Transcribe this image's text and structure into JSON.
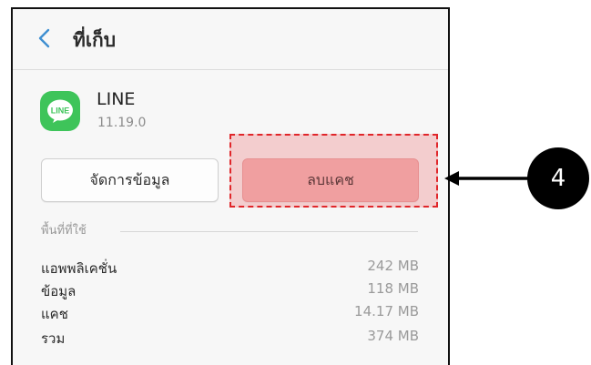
{
  "header": {
    "back_icon": "chevron-left-icon",
    "title": "ที่เก็บ"
  },
  "app": {
    "icon": "line-app-icon",
    "icon_text": "LINE",
    "name": "LINE",
    "version": "11.19.0"
  },
  "buttons": {
    "manage_data_label": "จัดการข้อมูล",
    "clear_cache_label": "ลบแคช"
  },
  "storage": {
    "section_label": "พื้นที่ที่ใช้",
    "rows": [
      {
        "label": "แอพพลิเคชั่น",
        "value": "242 MB"
      },
      {
        "label": "ข้อมูล",
        "value": "118 MB"
      },
      {
        "label": "แคช",
        "value": "14.17 MB"
      },
      {
        "label": "รวม",
        "value": "374 MB"
      }
    ]
  },
  "annotation": {
    "step_number": "4",
    "arrow_icon": "arrow-left-icon",
    "highlight_color": "#e0262a",
    "badge_color": "#000000"
  },
  "colors": {
    "accent": "#3f8fd1",
    "line_green": "#3ec45a"
  }
}
